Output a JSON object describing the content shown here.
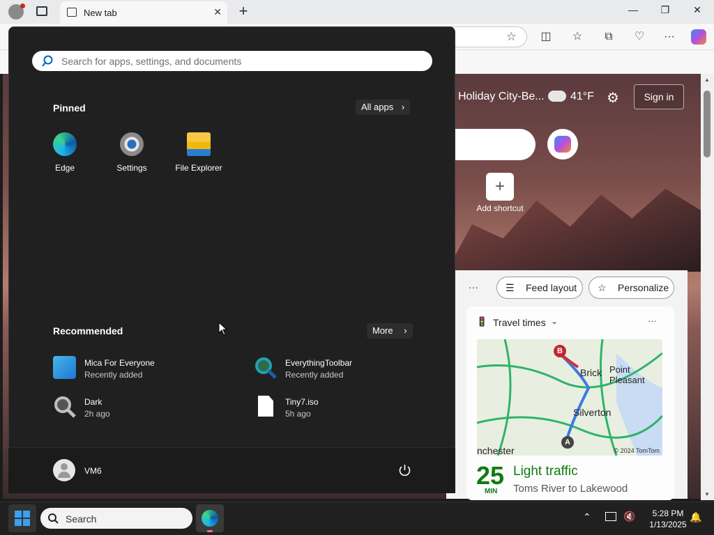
{
  "browser": {
    "tab_title": "New tab",
    "tab_close": "✕",
    "new_tab_btn": "+"
  },
  "window_controls": {
    "minimize": "—",
    "restore": "❐",
    "close": "✕"
  },
  "ntp": {
    "location": "Holiday City-Be...",
    "temperature": "41°F",
    "sign_in": "Sign in",
    "add_shortcut": "Add shortcut",
    "more_label": "···",
    "feed_layout": "Feed layout",
    "personalize": "Personalize",
    "travel_card": {
      "title": "Travel times",
      "minutes": "25",
      "min_label": "MIN",
      "status": "Light traffic",
      "route": "Toms River to Lakewood",
      "map_labels": [
        "Brick",
        "Point Pleasant",
        "Silverton",
        "nchester"
      ],
      "map_marker_a": "A",
      "map_marker_b": "B",
      "map_credit": "© 2024 TomTom"
    }
  },
  "start_menu": {
    "search_placeholder": "Search for apps, settings, and documents",
    "pinned_heading": "Pinned",
    "all_apps": "All apps",
    "pinned": [
      {
        "label": "Edge",
        "icon": "edge-icon"
      },
      {
        "label": "Settings",
        "icon": "gear-icon"
      },
      {
        "label": "File Explorer",
        "icon": "folder-icon"
      }
    ],
    "recommended_heading": "Recommended",
    "more": "More",
    "recommended": [
      {
        "name": "Mica For Everyone",
        "sub": "Recently added",
        "icon": "mica-icon"
      },
      {
        "name": "EverythingToolbar",
        "sub": "Recently added",
        "icon": "search-app-icon"
      },
      {
        "name": "Dark",
        "sub": "2h ago",
        "icon": "magnifier-icon"
      },
      {
        "name": "Tiny7.iso",
        "sub": "5h ago",
        "icon": "file-icon"
      }
    ],
    "user_name": "VM6"
  },
  "taskbar": {
    "search_label": "Search",
    "time": "5:28 PM",
    "date": "1/13/2025"
  },
  "colors": {
    "accent": "#0078d4",
    "start_bg": "#202020",
    "traffic_green": "#107c10"
  }
}
